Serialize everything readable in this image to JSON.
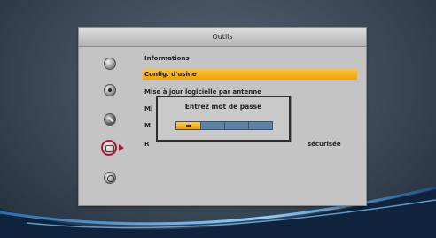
{
  "panel": {
    "title": "Outils",
    "items": [
      {
        "label": "Informations",
        "selected": false
      },
      {
        "label": "Config. d'usine",
        "selected": true
      },
      {
        "label": "Mise à jour logicielle par antenne",
        "selected": false
      },
      {
        "label": "Mi",
        "selected": false
      },
      {
        "label": "M",
        "selected": false
      },
      {
        "label": "R",
        "selected": false
      },
      {
        "label": "sécurisée",
        "selected": false
      }
    ],
    "icons": [
      "disc-icon",
      "target-icon",
      "wrench-icon",
      "tools-icon",
      "globe-icon"
    ]
  },
  "dialog": {
    "title": "Entrez mot de passe",
    "pin_total_digits": 4,
    "pin_entered_digits": 1,
    "pin_mask": "*"
  },
  "colors": {
    "highlight": "#f3a300",
    "selected_ring": "#b3143c",
    "pin_field": "#5d84a8"
  }
}
